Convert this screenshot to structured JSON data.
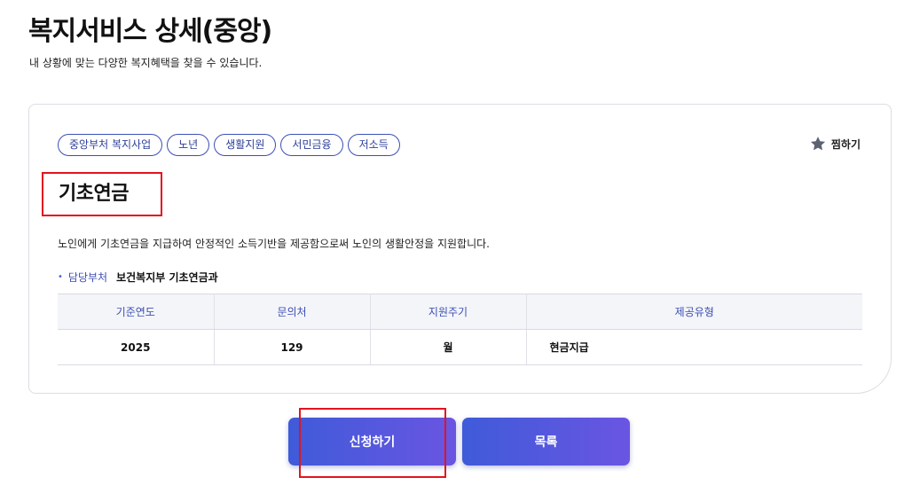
{
  "header": {
    "title": "복지서비스 상세(중앙)",
    "subtitle": "내 상황에 맞는 다양한 복지혜택을 찾을 수 있습니다."
  },
  "service": {
    "tags": [
      "중앙부처 복지사업",
      "노년",
      "생활지원",
      "서민금융",
      "저소득"
    ],
    "favorite_label": "찜하기",
    "name": "기초연금",
    "description": "노인에게 기초연금을 지급하여 안정적인 소득기반을 제공함으로써 노인의 생활안정을 지원합니다.",
    "department_label": "담당부처",
    "department_value": "보건복지부 기초연금과",
    "table": {
      "headers": [
        "기준연도",
        "문의처",
        "지원주기",
        "제공유형"
      ],
      "row": [
        "2025",
        "129",
        "월",
        "현금지급"
      ]
    }
  },
  "actions": {
    "apply_label": "신청하기",
    "list_label": "목록"
  },
  "colors": {
    "accent": "#3c4fb4",
    "button_gradient_start": "#3f5bd9",
    "button_gradient_end": "#6a55e2",
    "highlight_box": "#e1141e"
  },
  "icons": {
    "favorite": "star-icon",
    "department_bullet": "bullet-dot-icon"
  }
}
